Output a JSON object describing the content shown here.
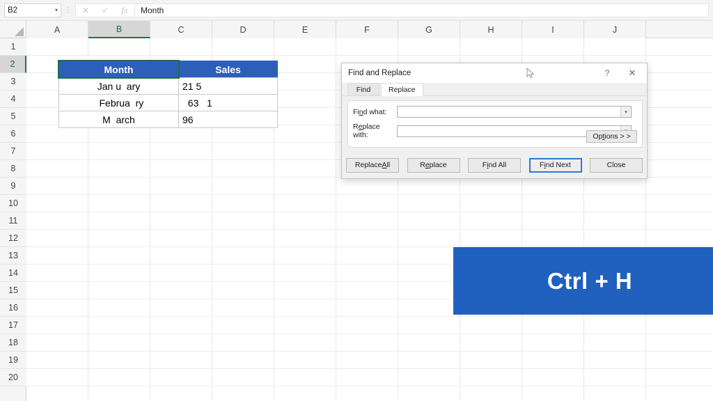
{
  "formula_bar": {
    "name_box_value": "B2",
    "name_box_caret": "▾",
    "dots_icon": "vertical-dots-icon",
    "cancel_icon": "✕",
    "enter_icon": "✓",
    "function_icon": "fx",
    "formula_value": "Month"
  },
  "grid": {
    "columns": [
      "A",
      "B",
      "C",
      "D",
      "E",
      "F",
      "G",
      "H",
      "I",
      "J"
    ],
    "selected_column": "B",
    "rows": [
      "1",
      "2",
      "3",
      "4",
      "5",
      "6",
      "7",
      "8",
      "9",
      "10",
      "11",
      "12",
      "13",
      "14",
      "15",
      "16",
      "17",
      "18",
      "19",
      "20"
    ],
    "selected_row": "2",
    "corner_icon": "select-all-triangle-icon"
  },
  "sheet_table": {
    "headers": [
      "Month",
      "Sales"
    ],
    "header_bg": "#2d5fb9",
    "rows": [
      {
        "month": "Jan u  ary",
        "sales": "21 5"
      },
      {
        "month": "  Februa  ry",
        "sales": "  63   1"
      },
      {
        "month": "M  arch",
        "sales": "96"
      }
    ],
    "active_cell": "B2"
  },
  "dialog": {
    "title": "Find and Replace",
    "help_icon": "?",
    "close_icon": "✕",
    "cursor_icon": "mouse-pointer-icon",
    "tabs": [
      {
        "label": "Find",
        "active": false
      },
      {
        "label": "Replace",
        "active": true
      }
    ],
    "fields": [
      {
        "label_pre": "Fi",
        "label_key": "n",
        "label_post": "d what:",
        "value": "",
        "placeholder": "",
        "arrow": "▾"
      },
      {
        "label_pre": "R",
        "label_key": "e",
        "label_post": "place with:",
        "value": "",
        "placeholder": "",
        "arrow": "▾"
      }
    ],
    "options_button": {
      "pre": "Op",
      "key": "t",
      "post": "ions > >"
    },
    "buttons": [
      {
        "pre": "Replace ",
        "key": "A",
        "post": "ll",
        "default": false
      },
      {
        "pre": "R",
        "key": "e",
        "post": "place",
        "default": false
      },
      {
        "pre": "F",
        "key": "i",
        "post": "nd All",
        "default": false
      },
      {
        "pre": "F",
        "key": "i",
        "post": "nd Next",
        "default": true
      },
      {
        "pre": "Close",
        "key": "",
        "post": "",
        "default": false
      }
    ]
  },
  "shortcut_banner": {
    "label": "Ctrl + H",
    "background": "#2060bf",
    "text_color": "#ffffff"
  }
}
